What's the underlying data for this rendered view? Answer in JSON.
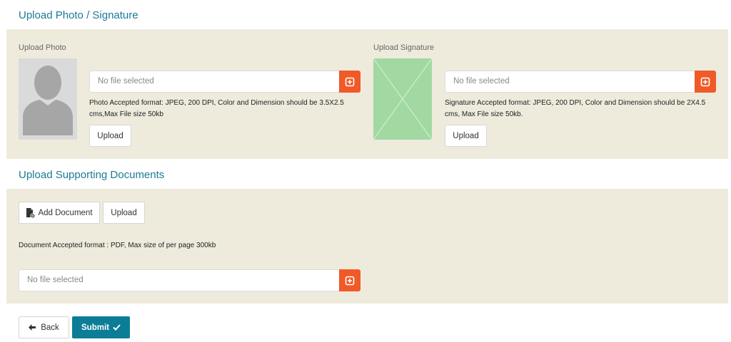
{
  "photo_section": {
    "title": "Upload Photo / Signature",
    "photo": {
      "label": "Upload Photo",
      "file_placeholder": "No file selected",
      "note": "Photo Accepted format: JPEG, 200 DPI, Color and Dimension should be 3.5X2.5 cms,Max File size 50kb",
      "upload_label": "Upload"
    },
    "signature": {
      "label": "Upload Signature",
      "file_placeholder": "No file selected",
      "note": "Signature Accepted format: JPEG, 200 DPI, Color and Dimension should be 2X4.5 cms, Max File size 50kb.",
      "upload_label": "Upload"
    }
  },
  "documents_section": {
    "title": "Upload Supporting Documents",
    "add_document_label": "Add Document",
    "upload_label": "Upload",
    "note": "Document Accepted format : PDF, Max size of per page 300kb",
    "file_placeholder": "No file selected"
  },
  "footer": {
    "back_label": "Back",
    "submit_label": "Submit"
  },
  "icons": {
    "avatar": "user-silhouette-icon",
    "signature_placeholder": "image-placeholder-icon",
    "browse": "crosshair-upload-icon",
    "add_document": "file-add-icon",
    "back": "arrow-left-icon",
    "submit": "check-icon"
  },
  "colors": {
    "accent": "#1a7a94",
    "panel_bg": "#eeebdd",
    "browse_btn": "#f05a28",
    "submit_btn": "#0c7d96",
    "signature_placeholder": "#a2d9a2"
  }
}
